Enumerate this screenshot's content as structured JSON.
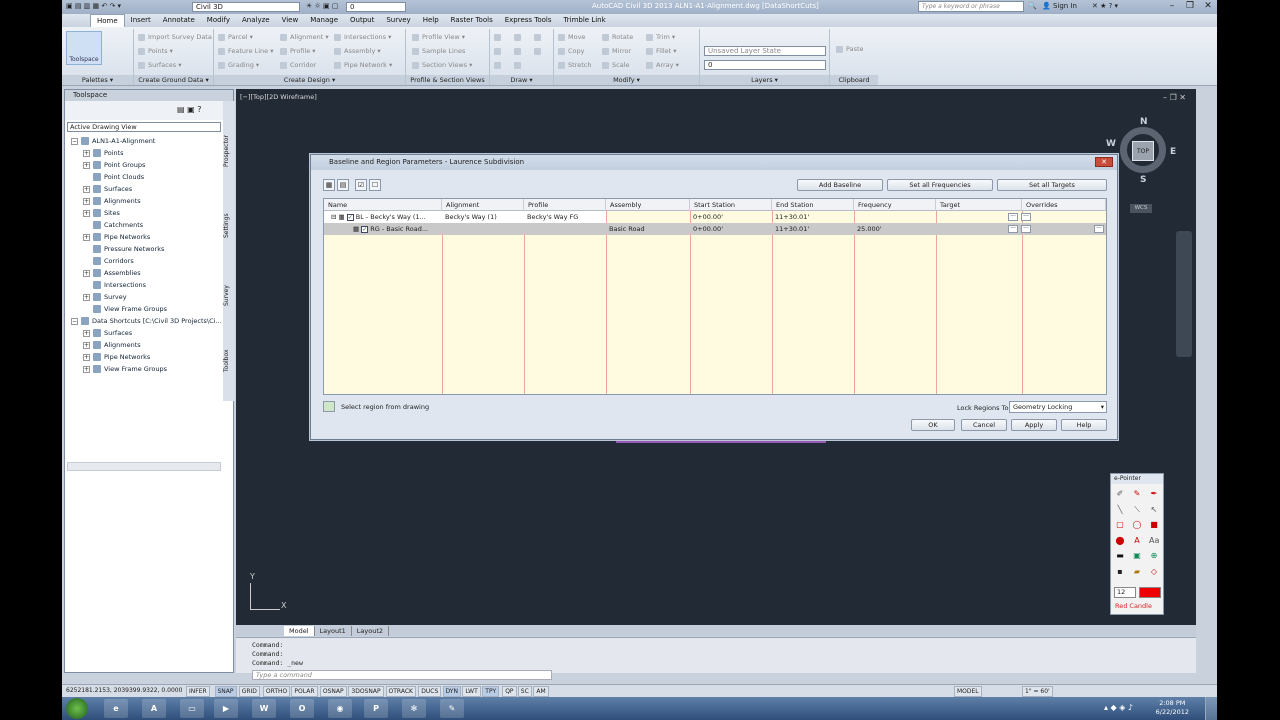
{
  "app": {
    "workspace": "Civil 3D",
    "layer_field": "0",
    "title": "AutoCAD Civil 3D 2013    ALN1-A1-Alignment.dwg [DataShortCuts]",
    "search_placeholder": "Type a keyword or phrase",
    "sign_in": "Sign In"
  },
  "menu": [
    "Home",
    "Insert",
    "Annotate",
    "Modify",
    "Analyze",
    "View",
    "Manage",
    "Output",
    "Survey",
    "Help",
    "Raster Tools",
    "Express Tools",
    "Trimble Link"
  ],
  "ribbon": {
    "toolspace": "Toolspace",
    "panels": [
      {
        "title": "Palettes ▾"
      },
      {
        "title": "Create Ground Data ▾",
        "items": [
          "Import Survey Data",
          "Points ▾",
          "Surfaces ▾"
        ]
      },
      {
        "title": "Create Design ▾",
        "items": [
          "Parcel ▾",
          "Feature Line ▾",
          "Grading ▾",
          "Alignment ▾",
          "Profile ▾",
          "Corridor",
          "Intersections ▾",
          "Assembly ▾",
          "Pipe Network ▾"
        ]
      },
      {
        "title": "Profile & Section Views",
        "items": [
          "Profile View ▾",
          "Sample Lines",
          "Section Views ▾"
        ]
      },
      {
        "title": "Draw ▾"
      },
      {
        "title": "Modify ▾",
        "items": [
          "Move",
          "Copy",
          "Stretch",
          "Rotate",
          "Mirror",
          "Scale",
          "Trim ▾",
          "Fillet ▾",
          "Array ▾"
        ]
      },
      {
        "title": "Layers ▾",
        "items": [
          "Unsaved Layer State",
          "0"
        ]
      },
      {
        "title": "Clipboard",
        "items": [
          "Paste"
        ]
      }
    ]
  },
  "toolspace": {
    "title": "Toolspace",
    "view": "Active Drawing View",
    "tabs": [
      "Prospector",
      "Settings",
      "Survey",
      "Toolbox"
    ],
    "tree": [
      {
        "label": "ALN1-A1-Alignment",
        "level": 0,
        "exp": "−"
      },
      {
        "label": "Points",
        "level": 1,
        "exp": "+"
      },
      {
        "label": "Point Groups",
        "level": 1,
        "exp": "+"
      },
      {
        "label": "Point Clouds",
        "level": 1,
        "exp": ""
      },
      {
        "label": "Surfaces",
        "level": 1,
        "exp": "+"
      },
      {
        "label": "Alignments",
        "level": 1,
        "exp": "+"
      },
      {
        "label": "Sites",
        "level": 1,
        "exp": "+"
      },
      {
        "label": "Catchments",
        "level": 1,
        "exp": ""
      },
      {
        "label": "Pipe Networks",
        "level": 1,
        "exp": "+"
      },
      {
        "label": "Pressure Networks",
        "level": 1,
        "exp": ""
      },
      {
        "label": "Corridors",
        "level": 1,
        "exp": ""
      },
      {
        "label": "Assemblies",
        "level": 1,
        "exp": "+"
      },
      {
        "label": "Intersections",
        "level": 1,
        "exp": ""
      },
      {
        "label": "Survey",
        "level": 1,
        "exp": "+"
      },
      {
        "label": "View Frame Groups",
        "level": 1,
        "exp": ""
      },
      {
        "label": "Data Shortcuts [C:\\Civil 3D Projects\\Ci...",
        "level": 0,
        "exp": "−"
      },
      {
        "label": "Surfaces",
        "level": 1,
        "exp": "+"
      },
      {
        "label": "Alignments",
        "level": 1,
        "exp": "+"
      },
      {
        "label": "Pipe Networks",
        "level": 1,
        "exp": "+"
      },
      {
        "label": "View Frame Groups",
        "level": 1,
        "exp": "+"
      }
    ]
  },
  "viewport": {
    "label": "[−][Top][2D Wireframe]",
    "viewcube": {
      "top": "TOP",
      "n": "N",
      "s": "S",
      "e": "E",
      "w": "W"
    },
    "wcs": "WCS",
    "ucs": {
      "x": "X",
      "y": "Y"
    }
  },
  "layout_tabs": [
    "Model",
    "Layout1",
    "Layout2"
  ],
  "command": {
    "lines": [
      "Command:",
      "Command:",
      "Command:  _new"
    ],
    "placeholder": "Type a command"
  },
  "status": {
    "coords": "6252181.2153, 2039399.9322, 0.0000",
    "toggles": [
      "INFER",
      "SNAP",
      "GRID",
      "ORTHO",
      "POLAR",
      "OSNAP",
      "3DOSNAP",
      "OTRACK",
      "DUCS",
      "DYN",
      "LWT",
      "TPY",
      "QP",
      "SC",
      "AM"
    ],
    "model": "MODEL",
    "scale": "1\" = 60'"
  },
  "dialog": {
    "title": "Baseline and Region Parameters - Laurence Subdivision",
    "buttons": {
      "add_baseline": "Add Baseline",
      "set_freq": "Set all Frequencies",
      "set_targets": "Set all Targets"
    },
    "columns": [
      "Name",
      "Alignment",
      "Profile",
      "Assembly",
      "Start Station",
      "End Station",
      "Frequency",
      "Target",
      "Overrides"
    ],
    "rows": [
      {
        "name": "BL - Becky's Way (1...",
        "alignment": "Becky's Way (1)",
        "profile": "Becky's Way FG",
        "assembly": "",
        "start": "0+00.00'",
        "end": "11+30.01'",
        "freq": ""
      },
      {
        "name": "RG - Basic Road...",
        "alignment": "",
        "profile": "",
        "assembly": "Basic Road",
        "start": "0+00.00'",
        "end": "11+30.01'",
        "freq": "25.000'"
      }
    ],
    "select_region": "Select region from drawing",
    "lock_label": "Lock Regions To:",
    "lock_value": "Geometry Locking",
    "ok": "OK",
    "cancel": "Cancel",
    "apply": "Apply",
    "help": "Help"
  },
  "epointer": {
    "title": "e-Pointer",
    "size": "12",
    "label": "Red Candle"
  },
  "taskbar": {
    "time": "2:08 PM",
    "date": "6/22/2012"
  }
}
